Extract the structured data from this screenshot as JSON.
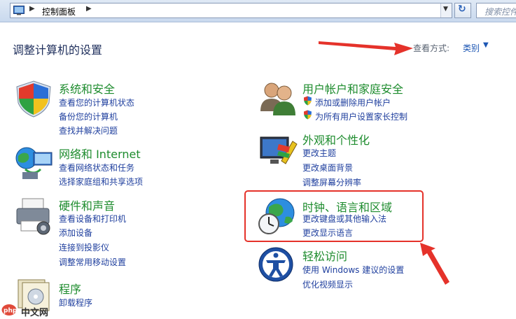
{
  "address_bar": {
    "path": "控制面板",
    "search_placeholder": "搜索控件"
  },
  "header": {
    "title": "调整计算机的设置",
    "view_by_label": "查看方式:",
    "view_by_value": "类别"
  },
  "categories": {
    "system": {
      "title": "系统和安全",
      "links": [
        "查看您的计算机状态",
        "备份您的计算机",
        "查找并解决问题"
      ]
    },
    "network": {
      "title": "网络和 Internet",
      "links": [
        "查看网络状态和任务",
        "选择家庭组和共享选项"
      ]
    },
    "hardware": {
      "title": "硬件和声音",
      "links": [
        "查看设备和打印机",
        "添加设备",
        "连接到投影仪",
        "调整常用移动设置"
      ]
    },
    "programs": {
      "title": "程序",
      "links": [
        "卸载程序"
      ]
    },
    "users": {
      "title": "用户帐户和家庭安全",
      "links": [
        "添加或删除用户帐户",
        "为所有用户设置家长控制"
      ]
    },
    "appearance": {
      "title": "外观和个性化",
      "links": [
        "更改主题",
        "更改桌面背景",
        "调整屏幕分辨率"
      ]
    },
    "clock": {
      "title": "时钟、语言和区域",
      "links": [
        "更改键盘或其他输入法",
        "更改显示语言"
      ]
    },
    "ease": {
      "title": "轻松访问",
      "links": [
        "使用 Windows 建议的设置",
        "优化视频显示"
      ]
    }
  },
  "watermark": {
    "text": "中文网",
    "logo_text": "php"
  },
  "colors": {
    "category_title": "#1e8c2e",
    "link": "#1f3f9e",
    "annotation": "#e5322a",
    "page_title": "#1f2f5c"
  }
}
